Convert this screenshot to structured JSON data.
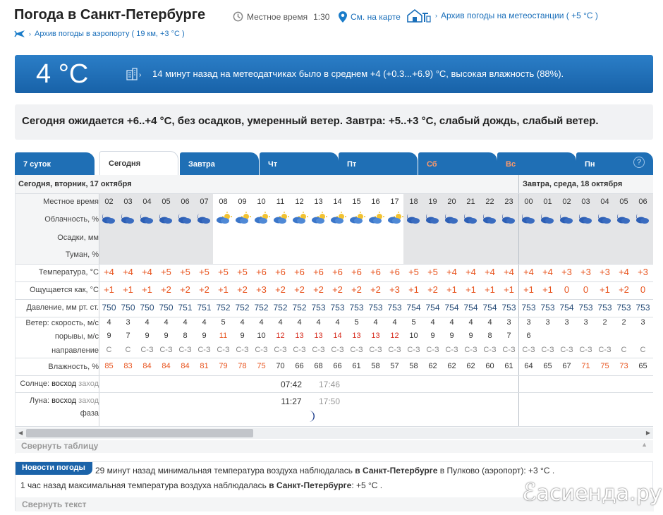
{
  "header": {
    "title": "Погода в Санкт-Петербурге",
    "local_time_label": "Местное время",
    "local_time": "1:30",
    "map_link": "См. на карте",
    "station_archive": "Архив погоды на метеостанции ( +5 °C )",
    "airport_archive": "Архив погоды в аэропорту ( 19 км, +3 °C )"
  },
  "current": {
    "temp": "4 °C",
    "text": "14 минут назад на метеодатчиках было в среднем +4 (+0.3...+6.9) °C, высокая влажность (88%)."
  },
  "summary": "Сегодня ожидается +6..+4 °C, без осадков, умеренный ветер. Завтра: +5..+3 °C, слабый дождь, слабый ветер.",
  "tabs": [
    {
      "label": "7 суток"
    },
    {
      "label": "Сегодня"
    },
    {
      "label": "Завтра"
    },
    {
      "label": "Чт"
    },
    {
      "label": "Пт"
    },
    {
      "label": "Сб"
    },
    {
      "label": "Вс"
    },
    {
      "label": "Пн"
    }
  ],
  "table": {
    "day1": "Сегодня, вторник, 17 октября",
    "day2": "Завтра, среда, 18 октября",
    "row_labels": {
      "time": "Местное время",
      "cloud": "Облачность, %",
      "precip": "Осадки, мм",
      "fog": "Туман, %",
      "temp": "Температура, °C",
      "feels": "Ощущается как, °C",
      "pressure": "Давление, мм рт. ст.",
      "wind_speed": "Ветер: скорость, м/с",
      "gusts": "порывы, м/с",
      "direction": "направление",
      "humidity": "Влажность, %",
      "sun_prefix": "Солнце: ",
      "sun_rise": "восход",
      "sun_set": "заход",
      "moon_prefix": "Луна: ",
      "moon_rise": "восход",
      "moon_set": "заход",
      "moon_phase": "фаза"
    },
    "hours": [
      "02",
      "03",
      "04",
      "05",
      "06",
      "07",
      "08",
      "09",
      "10",
      "11",
      "12",
      "13",
      "14",
      "15",
      "16",
      "17",
      "18",
      "19",
      "20",
      "21",
      "22",
      "23",
      "00",
      "01",
      "02",
      "03",
      "04",
      "05",
      "06"
    ],
    "temp": [
      "+4",
      "+4",
      "+4",
      "+5",
      "+5",
      "+5",
      "+5",
      "+5",
      "+6",
      "+6",
      "+6",
      "+6",
      "+6",
      "+6",
      "+6",
      "+6",
      "+5",
      "+5",
      "+4",
      "+4",
      "+4",
      "+4",
      "+4",
      "+4",
      "+3",
      "+3",
      "+3",
      "+4",
      "+3"
    ],
    "feels": [
      "+1",
      "+1",
      "+1",
      "+2",
      "+2",
      "+2",
      "+1",
      "+2",
      "+3",
      "+2",
      "+2",
      "+2",
      "+2",
      "+2",
      "+2",
      "+3",
      "+1",
      "+2",
      "+1",
      "+1",
      "+1",
      "+1",
      "+1",
      "+1",
      "0",
      "0",
      "+1",
      "+2",
      "0"
    ],
    "pressure": [
      "750",
      "750",
      "750",
      "750",
      "751",
      "751",
      "752",
      "752",
      "752",
      "752",
      "752",
      "753",
      "753",
      "753",
      "753",
      "753",
      "754",
      "754",
      "754",
      "754",
      "754",
      "753",
      "753",
      "753",
      "754",
      "753",
      "753",
      "753",
      "753"
    ],
    "wind": [
      "4",
      "3",
      "4",
      "4",
      "4",
      "4",
      "5",
      "4",
      "4",
      "4",
      "4",
      "4",
      "4",
      "5",
      "4",
      "4",
      "5",
      "4",
      "4",
      "4",
      "4",
      "3",
      "3",
      "3",
      "3",
      "3",
      "2",
      "2",
      "3"
    ],
    "gusts": [
      "9",
      "7",
      "9",
      "9",
      "8",
      "9",
      "11",
      "9",
      "10",
      "12",
      "13",
      "13",
      "14",
      "13",
      "13",
      "12",
      "10",
      "9",
      "9",
      "9",
      "8",
      "7",
      "6",
      "",
      "",
      "",
      "",
      "",
      ""
    ],
    "dir": [
      "С",
      "С",
      "С-З",
      "С-З",
      "С-З",
      "С-З",
      "С-З",
      "С-З",
      "С-З",
      "С-З",
      "С-З",
      "С-З",
      "С-З",
      "С-З",
      "С-З",
      "С-З",
      "С-З",
      "С-З",
      "С-З",
      "С-З",
      "С-З",
      "С-З",
      "С-З",
      "С-З",
      "С-З",
      "С-З",
      "С-З",
      "С",
      "С"
    ],
    "humidity": [
      "85",
      "83",
      "84",
      "84",
      "84",
      "81",
      "79",
      "78",
      "75",
      "70",
      "66",
      "68",
      "66",
      "61",
      "58",
      "57",
      "58",
      "62",
      "62",
      "62",
      "60",
      "61",
      "64",
      "65",
      "67",
      "71",
      "75",
      "73",
      "65"
    ],
    "sunrise": "07:42",
    "sunset": "17:46",
    "moonrise": "11:27",
    "moonset": "17:50"
  },
  "fold_table": "Свернуть таблицу",
  "news": {
    "tag": "Новости погоды",
    "l1_a": "29 минут назад минимальная температура воздуха наблюдалась ",
    "l1_b": "в Санкт-Петербурге",
    "l1_c": " в Пулково (аэропорт): +3 °C .",
    "l2_a": "1 час назад максимальная температура воздуха наблюдалась ",
    "l2_b": "в Санкт-Петербурге",
    "l2_c": ": +5 °C .",
    "fold": "Свернуть текст"
  },
  "watermark": "асиенда.ру",
  "colors": {
    "accent": "#1f6fb5",
    "warm": "#e8541e",
    "hot": "#d6291b"
  }
}
